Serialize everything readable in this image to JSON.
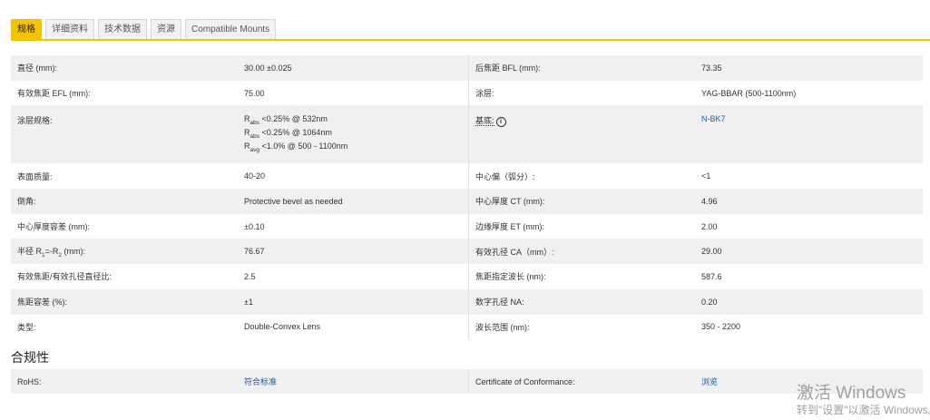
{
  "tabs": [
    "规格",
    "详细资料",
    "技术数据",
    "资源",
    "Compatible Mounts"
  ],
  "colors": {
    "accent": "#f5c400",
    "link": "#1a5fa8",
    "row_alt": "#f0f0f0"
  },
  "spec": {
    "r0": {
      "l1": "直径 (mm):",
      "v1": "30.00 ±0.025",
      "l2": "后焦距 BFL (mm):",
      "v2": "73.35"
    },
    "r1": {
      "l1": "有效焦距 EFL (mm):",
      "v1": "75.00",
      "l2": "涂层:",
      "v2": "YAG-BBAR (500-1100nm)"
    },
    "r2": {
      "l1": "涂层规格:",
      "coat": [
        {
          "r": "R",
          "sub": "abs",
          "rest": " <0.25% @ 532nm"
        },
        {
          "r": "R",
          "sub": "abs",
          "rest": " <0.25% @ 1064nm"
        },
        {
          "r": "R",
          "sub": "avg",
          "rest": " <1.0% @ 500 - 1100nm"
        }
      ],
      "l2": "基底:",
      "v2": "N-BK7"
    },
    "r3": {
      "l1": "表面质量:",
      "v1": "40-20",
      "l2": "中心偏（弧分）:",
      "v2": "<1"
    },
    "r4": {
      "l1": "倒角:",
      "v1": "Protective bevel as needed",
      "l2": "中心厚度 CT (mm):",
      "v2": "4.96"
    },
    "r5": {
      "l1": "中心厚度容差 (mm):",
      "v1": "±0.10",
      "l2": "边缘厚度 ET (mm):",
      "v2": "2.00"
    },
    "r6": {
      "l1_a": "半径 R",
      "l1_s1": "1",
      "l1_b": "=-R",
      "l1_s2": "2",
      "l1_c": " (mm):",
      "v1": "76.67",
      "l2": "有效孔径 CA（mm）:",
      "v2": "29.00"
    },
    "r7": {
      "l1": "有效焦距/有效孔径直径比:",
      "v1": "2.5",
      "l2": "焦距指定波长 (nm):",
      "v2": "587.6"
    },
    "r8": {
      "l1": "焦距容差 (%):",
      "v1": "±1",
      "l2": "数字孔径 NA:",
      "v2": "0.20"
    },
    "r9": {
      "l1": "类型:",
      "v1": "Double-Convex Lens",
      "l2": "波长范围 (nm):",
      "v2": "350 - 2200"
    }
  },
  "compliance": {
    "heading": "合规性",
    "l1": "RoHS:",
    "v1": "符合标准",
    "l2": "Certificate of Conformance:",
    "v2": "浏览"
  },
  "watermark": {
    "line1": "激活 Windows",
    "line2": "转到\"设置\"以激活 Windows。"
  }
}
